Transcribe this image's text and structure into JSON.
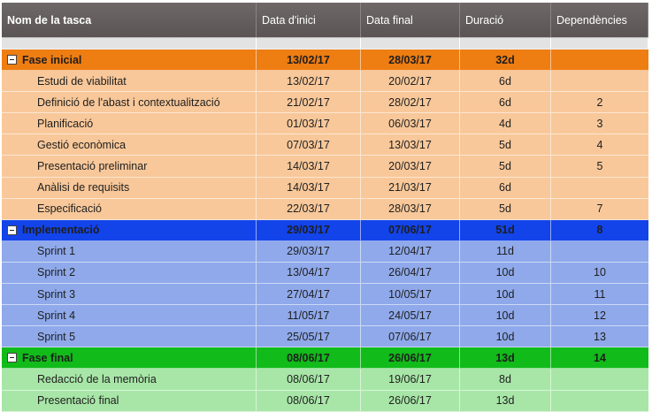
{
  "headers": [
    "Nom de la tasca",
    "Data d'inici",
    "Data final",
    "Duració",
    "Dependències"
  ],
  "phases": [
    {
      "name": "Fase inicial",
      "start": "13/02/17",
      "end": "28/03/17",
      "duration": "32d",
      "deps": "",
      "color": "#ee7d12",
      "child_color": "#f8c89a",
      "tasks": [
        {
          "name": "Estudi de viabilitat",
          "start": "13/02/17",
          "end": "20/02/17",
          "duration": "6d",
          "deps": ""
        },
        {
          "name": "Definició de l'abast i contextualització",
          "start": "21/02/17",
          "end": "28/02/17",
          "duration": "6d",
          "deps": "2"
        },
        {
          "name": "Planificació",
          "start": "01/03/17",
          "end": "06/03/17",
          "duration": "4d",
          "deps": "3"
        },
        {
          "name": "Gestió econòmica",
          "start": "07/03/17",
          "end": "13/03/17",
          "duration": "5d",
          "deps": "4"
        },
        {
          "name": "Presentació preliminar",
          "start": "14/03/17",
          "end": "20/03/17",
          "duration": "5d",
          "deps": "5"
        },
        {
          "name": "Anàlisi de requisits",
          "start": "14/03/17",
          "end": "21/03/17",
          "duration": "6d",
          "deps": ""
        },
        {
          "name": "Especificació",
          "start": "22/03/17",
          "end": "28/03/17",
          "duration": "5d",
          "deps": "7"
        }
      ]
    },
    {
      "name": "Implementació",
      "start": "29/03/17",
      "end": "07/06/17",
      "duration": "51d",
      "deps": "8",
      "color": "#1244ea",
      "child_color": "#8fa9ea",
      "tasks": [
        {
          "name": "Sprint 1",
          "start": "29/03/17",
          "end": "12/04/17",
          "duration": "11d",
          "deps": ""
        },
        {
          "name": "Sprint 2",
          "start": "13/04/17",
          "end": "26/04/17",
          "duration": "10d",
          "deps": "10"
        },
        {
          "name": "Sprint 3",
          "start": "27/04/17",
          "end": "10/05/17",
          "duration": "10d",
          "deps": "11"
        },
        {
          "name": "Sprint 4",
          "start": "11/05/17",
          "end": "24/05/17",
          "duration": "10d",
          "deps": "12"
        },
        {
          "name": "Sprint 5",
          "start": "25/05/17",
          "end": "07/06/17",
          "duration": "10d",
          "deps": "13"
        }
      ]
    },
    {
      "name": "Fase final",
      "start": "08/06/17",
      "end": "26/06/17",
      "duration": "13d",
      "deps": "14",
      "color": "#11bb1a",
      "child_color": "#a8e6a8",
      "tasks": [
        {
          "name": "Redacció de la memòria",
          "start": "08/06/17",
          "end": "19/06/17",
          "duration": "8d",
          "deps": ""
        },
        {
          "name": "Presentació final",
          "start": "08/06/17",
          "end": "26/06/17",
          "duration": "13d",
          "deps": ""
        }
      ]
    }
  ]
}
